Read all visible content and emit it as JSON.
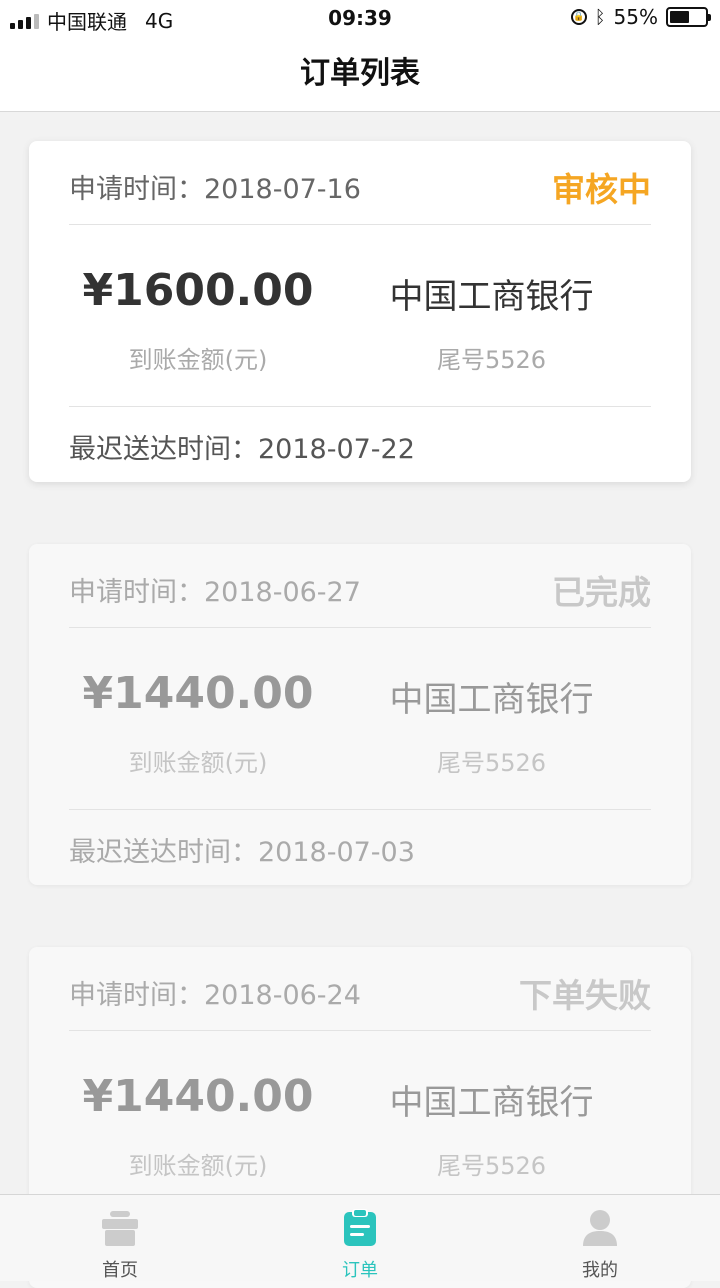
{
  "status_bar": {
    "carrier": "中国联通",
    "network": "4G",
    "time": "09:39",
    "battery_text": "55%",
    "battery_level": 0.55,
    "icons": [
      "signal-icon",
      "orientation-lock-icon",
      "bluetooth-icon",
      "battery-icon"
    ]
  },
  "nav": {
    "title": "订单列表"
  },
  "orders": [
    {
      "apply_label": "申请时间：",
      "apply_date": "2018-07-16",
      "status": "审核中",
      "status_color": "#f5a623",
      "amount": "¥1600.00",
      "amount_label": "到账金额(元)",
      "bank": "中国工商银行",
      "card_tail": "尾号5526",
      "deadline_label": "最迟送达时间：",
      "deadline_date": "2018-07-22"
    },
    {
      "apply_label": "申请时间：",
      "apply_date": "2018-06-27",
      "status": "已完成",
      "status_color": "#c8c8c8",
      "amount": "¥1440.00",
      "amount_label": "到账金额(元)",
      "bank": "中国工商银行",
      "card_tail": "尾号5526",
      "deadline_label": "最迟送达时间：",
      "deadline_date": "2018-07-03"
    },
    {
      "apply_label": "申请时间：",
      "apply_date": "2018-06-24",
      "status": "下单失败",
      "status_color": "#c8c8c8",
      "amount": "¥1440.00",
      "amount_label": "到账金额(元)",
      "bank": "中国工商银行",
      "card_tail": "尾号5526"
    }
  ],
  "tabs": [
    {
      "label": "首页",
      "icon": "gift-icon",
      "active": false
    },
    {
      "label": "订单",
      "icon": "clipboard-icon",
      "active": true
    },
    {
      "label": "我的",
      "icon": "user-icon",
      "active": false
    }
  ],
  "colors": {
    "accent": "#2bc4bd",
    "pending": "#f5a623",
    "inactive_icon": "#cccccc"
  }
}
